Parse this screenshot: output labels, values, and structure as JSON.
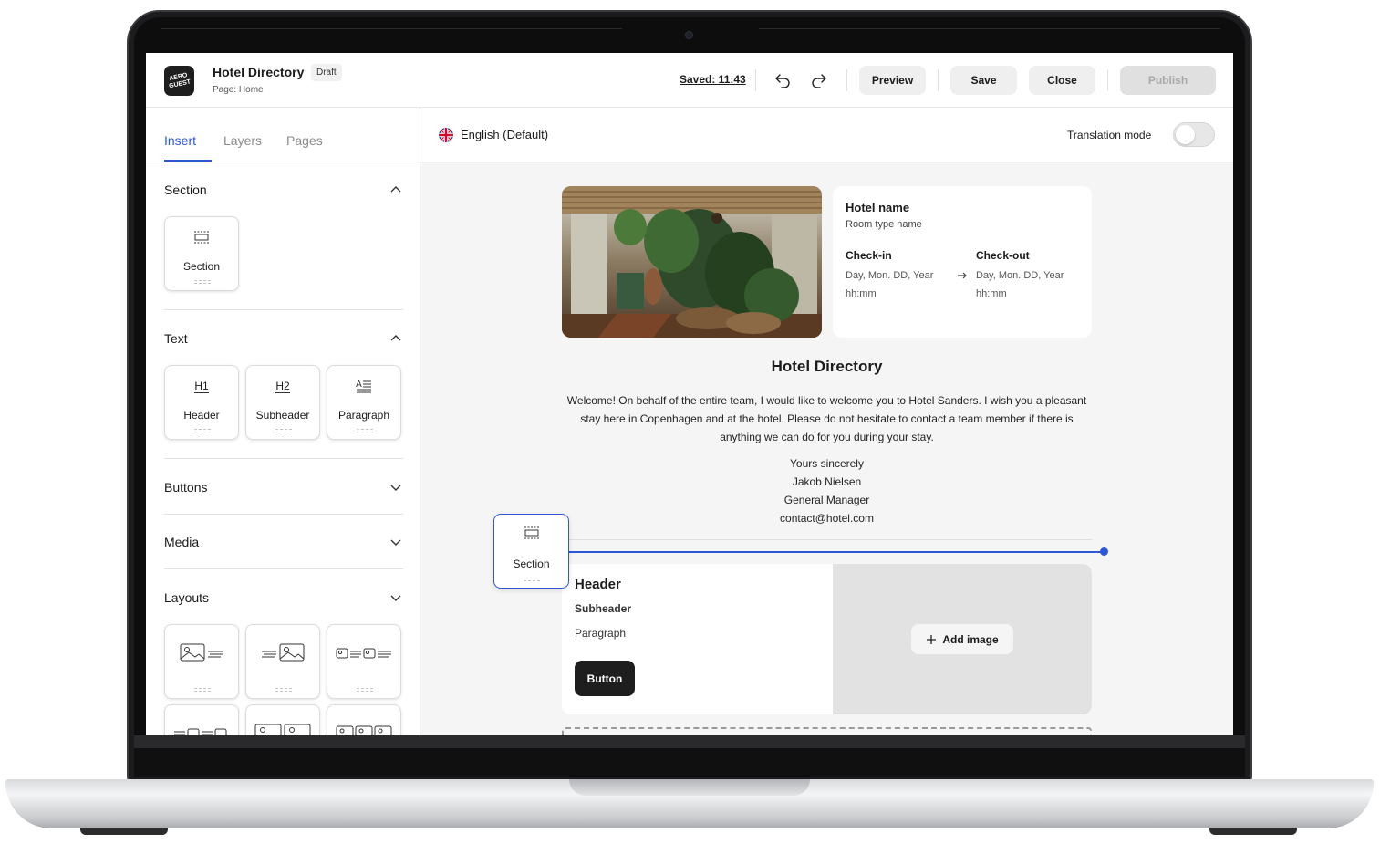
{
  "app": {
    "logo_text": "AERO GUEST",
    "doc_title": "Hotel Directory",
    "draft_badge": "Draft",
    "page_label": "Page: Home",
    "saved_text": "Saved: 11:43",
    "preview_label": "Preview",
    "save_label": "Save",
    "close_label": "Close",
    "publish_label": "Publish",
    "accent_color": "#2f57d5"
  },
  "sidebar": {
    "tabs": [
      "Insert",
      "Layers",
      "Pages"
    ],
    "active_tab": "Insert",
    "groups": {
      "section": {
        "title": "Section",
        "expanded": true,
        "items": [
          "Section"
        ]
      },
      "text": {
        "title": "Text",
        "expanded": true,
        "items": [
          "Header",
          "Subheader",
          "Paragraph"
        ],
        "icon_text": [
          "H1",
          "H2"
        ]
      },
      "buttons": {
        "title": "Buttons",
        "expanded": false
      },
      "media": {
        "title": "Media",
        "expanded": false
      },
      "layouts": {
        "title": "Layouts",
        "expanded": true
      }
    }
  },
  "canvas": {
    "language": "English (Default)",
    "translation_mode_label": "Translation mode",
    "translation_mode_on": false,
    "booking": {
      "hotel_name": "Hotel name",
      "room_type": "Room type name",
      "checkin_label": "Check-in",
      "checkout_label": "Check-out",
      "checkin_date": "Day, Mon. DD, Year",
      "checkin_time": "hh:mm",
      "checkout_date": "Day, Mon. DD, Year",
      "checkout_time": "hh:mm"
    },
    "directory_title": "Hotel Directory",
    "welcome_text": "Welcome! On behalf of the entire team, I would like to welcome you to Hotel Sanders. I wish you a pleasant stay here in Copenhagen and at the hotel. Please do not hesitate to contact a team member if there is anything we can do for you during your stay.",
    "signature": {
      "closing": "Yours sincerely",
      "name": "Jakob Nielsen",
      "role": "General Manager",
      "email": "contact@hotel.com"
    },
    "drag_tile_label": "Section",
    "new_section": {
      "header": "Header",
      "subheader": "Subheader",
      "paragraph": "Paragraph",
      "button_label": "Button",
      "add_image_label": "Add image"
    }
  }
}
